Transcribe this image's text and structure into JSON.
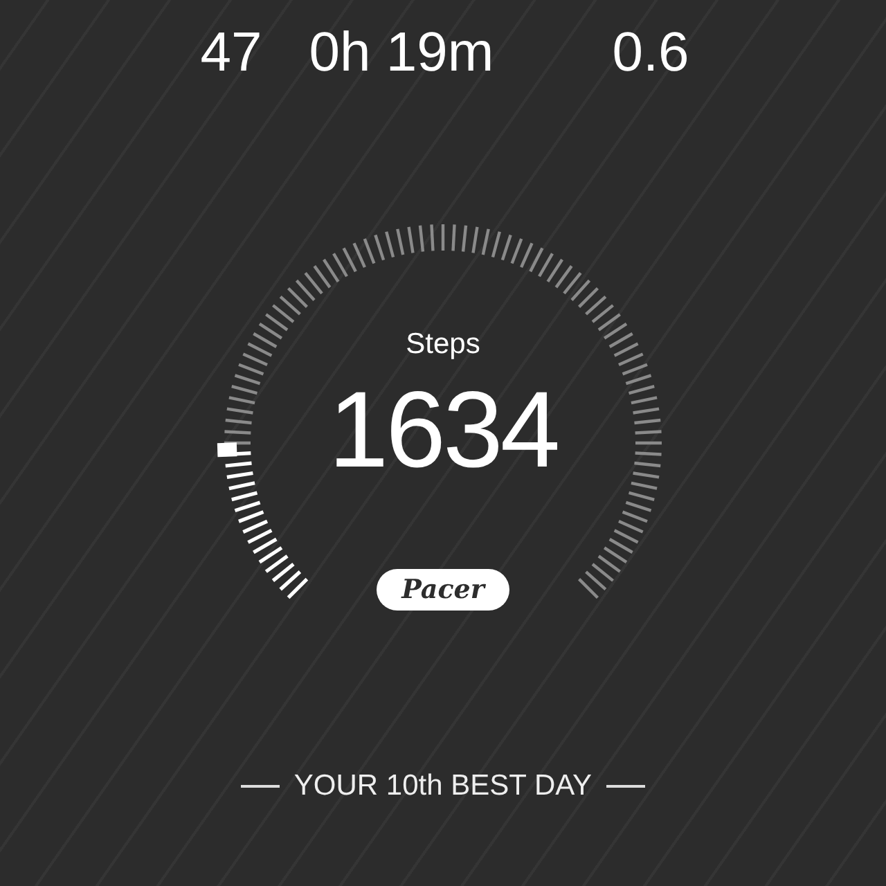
{
  "stats": [
    {
      "value": "47"
    },
    {
      "value": "0h 19m"
    },
    {
      "value": "0.6"
    }
  ],
  "gauge": {
    "label": "Steps",
    "value": "1634"
  },
  "badge": {
    "text": "Pacer"
  },
  "rank": {
    "text": "YOUR 10th BEST DAY"
  }
}
